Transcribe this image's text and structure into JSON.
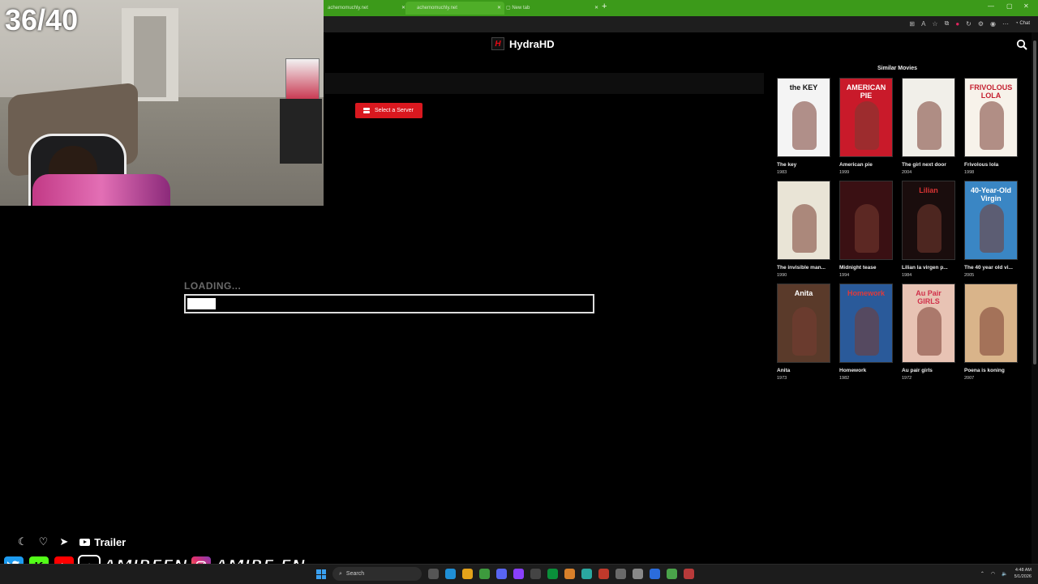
{
  "browser": {
    "tabs": [
      {
        "label": "achemomuchly.net",
        "active": false
      },
      {
        "label": "achemomuchly.net",
        "active": true
      },
      {
        "label": "New tab",
        "active": false
      }
    ],
    "new_tab_symbol": "+",
    "toolbar_icons": [
      "extensions-icon",
      "read-aloud-icon",
      "favorite-icon",
      "collections-icon",
      "pocket-icon",
      "refresh-icon",
      "settings-icon",
      "profile-icon",
      "more-icon"
    ],
    "chat_label": "Chat",
    "accent": "#3c9a1a"
  },
  "site": {
    "logo_letter": "H",
    "name": "HydraHD",
    "brand_color": "#e50914"
  },
  "player": {
    "server_button_label": "Select a Server",
    "loading_text": "LOADING...",
    "progress": 0.07
  },
  "similar": {
    "heading": "Similar Movies",
    "movies": [
      {
        "title": "The key",
        "year": "1983",
        "poster_text": "the KEY",
        "poster_color": "#f4f4f4",
        "text_color": "#111"
      },
      {
        "title": "American pie",
        "year": "1999",
        "poster_text": "AMERICAN PIE",
        "poster_color": "#c91a2a",
        "text_color": "#fff"
      },
      {
        "title": "The girl next door",
        "year": "2004",
        "poster_text": "",
        "poster_color": "#f1efe9",
        "text_color": "#c41e2e"
      },
      {
        "title": "Frivolous lola",
        "year": "1998",
        "poster_text": "FRIVOLOUS LOLA",
        "poster_color": "#f7f2ea",
        "text_color": "#c41e2e"
      },
      {
        "title": "The invisible man...",
        "year": "1990",
        "poster_text": "",
        "poster_color": "#e9e4d6",
        "text_color": "#111"
      },
      {
        "title": "Midnight tease",
        "year": "1994",
        "poster_text": "",
        "poster_color": "#3a1013",
        "text_color": "#fff"
      },
      {
        "title": "Lilian la virgen p...",
        "year": "1984",
        "poster_text": "Lilian",
        "poster_color": "#1a0d0d",
        "text_color": "#d93434"
      },
      {
        "title": "The 40 year old vi...",
        "year": "2005",
        "poster_text": "40-Year-Old Virgin",
        "poster_color": "#3a86c4",
        "text_color": "#fff"
      },
      {
        "title": "Anita",
        "year": "1973",
        "poster_text": "Anita",
        "poster_color": "#5a3a2a",
        "text_color": "#fff"
      },
      {
        "title": "Homework",
        "year": "1982",
        "poster_text": "Homework",
        "poster_color": "#2a5a9a",
        "text_color": "#e03a3a"
      },
      {
        "title": "Au pair girls",
        "year": "1972",
        "poster_text": "Au Pair GIRLS",
        "poster_color": "#e8c3b4",
        "text_color": "#d0304a"
      },
      {
        "title": "Poena is koning",
        "year": "2007",
        "poster_text": "",
        "poster_color": "#d9b48a",
        "text_color": "#222"
      }
    ]
  },
  "stream_overlay": {
    "counter": "36/40",
    "trailer_label": "Trailer",
    "handle_primary": "AMIREFN",
    "handle_secondary": "AMIRE.FN",
    "social_icons": [
      "twitter-icon",
      "kick-icon",
      "youtube-icon",
      "tiktok-icon",
      "instagram-icon"
    ]
  },
  "taskbar": {
    "search_placeholder": "Search",
    "time": "4:48 AM",
    "date": "5/1/2026"
  }
}
